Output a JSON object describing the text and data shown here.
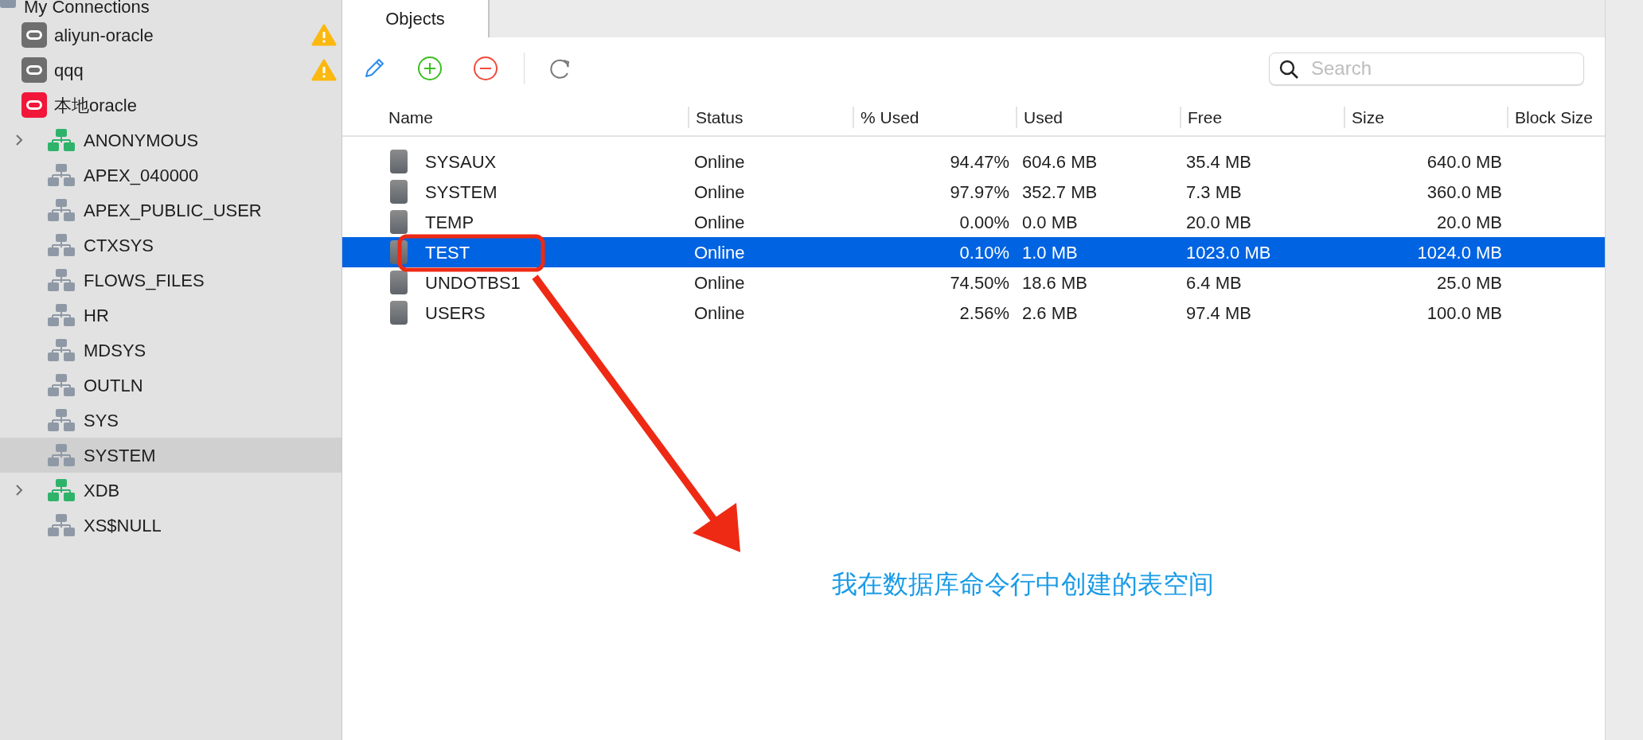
{
  "sidebar": {
    "header": "My Connections",
    "connections": [
      {
        "name": "aliyun-oracle",
        "connected": false,
        "warning": true,
        "selected": false
      },
      {
        "name": "qqq",
        "connected": false,
        "warning": true,
        "selected": false
      },
      {
        "name": "本地oracle",
        "connected": true,
        "warning": false,
        "selected": false,
        "children": [
          {
            "name": "ANONYMOUS",
            "expandable": true,
            "selected": false
          },
          {
            "name": "APEX_040000",
            "expandable": false,
            "selected": false
          },
          {
            "name": "APEX_PUBLIC_USER",
            "expandable": false,
            "selected": false
          },
          {
            "name": "CTXSYS",
            "expandable": false,
            "selected": false
          },
          {
            "name": "FLOWS_FILES",
            "expandable": false,
            "selected": false
          },
          {
            "name": "HR",
            "expandable": false,
            "selected": false
          },
          {
            "name": "MDSYS",
            "expandable": false,
            "selected": false
          },
          {
            "name": "OUTLN",
            "expandable": false,
            "selected": false
          },
          {
            "name": "SYS",
            "expandable": false,
            "selected": false
          },
          {
            "name": "SYSTEM",
            "expandable": false,
            "selected": true
          },
          {
            "name": "XDB",
            "expandable": true,
            "selected": false
          },
          {
            "name": "XS$NULL",
            "expandable": false,
            "selected": false
          }
        ]
      }
    ]
  },
  "tabs": [
    {
      "label": "Objects",
      "selected": true
    }
  ],
  "search": {
    "placeholder": "Search"
  },
  "table": {
    "columns": [
      "Name",
      "Status",
      "% Used",
      "Used",
      "Free",
      "Size",
      "Block Size"
    ],
    "rows": [
      {
        "name": "SYSAUX",
        "status": "Online",
        "pct_used": "94.47%",
        "used": "604.6 MB",
        "free": "35.4 MB",
        "size": "640.0 MB",
        "selected": false
      },
      {
        "name": "SYSTEM",
        "status": "Online",
        "pct_used": "97.97%",
        "used": "352.7 MB",
        "free": "7.3 MB",
        "size": "360.0 MB",
        "selected": false
      },
      {
        "name": "TEMP",
        "status": "Online",
        "pct_used": "0.00%",
        "used": "0.0 MB",
        "free": "20.0 MB",
        "size": "20.0 MB",
        "selected": false
      },
      {
        "name": "TEST",
        "status": "Online",
        "pct_used": "0.10%",
        "used": "1.0 MB",
        "free": "1023.0 MB",
        "size": "1024.0 MB",
        "selected": true
      },
      {
        "name": "UNDOTBS1",
        "status": "Online",
        "pct_used": "74.50%",
        "used": "18.6 MB",
        "free": "6.4 MB",
        "size": "25.0 MB",
        "selected": false
      },
      {
        "name": "USERS",
        "status": "Online",
        "pct_used": "2.56%",
        "used": "2.6 MB",
        "free": "97.4 MB",
        "size": "100.0 MB",
        "selected": false
      }
    ]
  },
  "annotation": {
    "text": "我在数据库命令行中创建的表空间"
  }
}
